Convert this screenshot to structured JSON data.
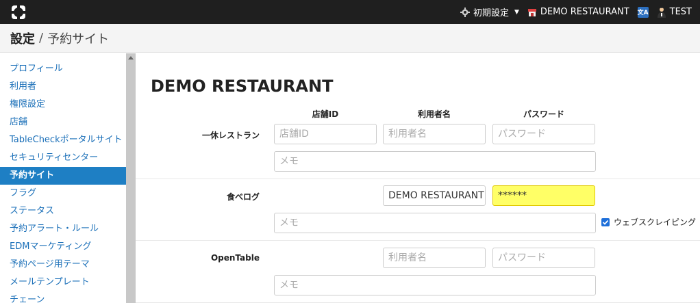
{
  "topbar": {
    "initial_settings": "初期設定",
    "restaurant": "DEMO RESTAURANT",
    "user": "TEST"
  },
  "breadcrumb": {
    "main": "設定",
    "separator": "/",
    "sub": "予約サイト"
  },
  "sidebar": {
    "items": [
      {
        "label": "プロフィール"
      },
      {
        "label": "利用者"
      },
      {
        "label": "権限設定"
      },
      {
        "label": "店舗"
      },
      {
        "label": "TableCheckポータルサイト"
      },
      {
        "label": "セキュリティセンター"
      },
      {
        "label": "予約サイト"
      },
      {
        "label": "フラグ"
      },
      {
        "label": "ステータス"
      },
      {
        "label": "予約アラート・ルール"
      },
      {
        "label": "EDMマーケティング"
      },
      {
        "label": "予約ページ用テーマ"
      },
      {
        "label": "メールテンプレート"
      },
      {
        "label": "チェーン"
      }
    ]
  },
  "main": {
    "title": "DEMO RESTAURANT",
    "columns": {
      "store_id": "店舗ID",
      "username": "利用者名",
      "password": "パスワード"
    },
    "sites": {
      "ikyu": {
        "label": "一休レストラン",
        "store_id_placeholder": "店舗ID",
        "username_placeholder": "利用者名",
        "password_placeholder": "パスワード",
        "memo_placeholder": "メモ"
      },
      "tabelog": {
        "label": "食べログ",
        "username_value": "DEMO RESTAURANT",
        "password_value": "******",
        "memo_placeholder": "メモ",
        "scraping_label": "ウェブスクレイピング",
        "scraping_checked": true
      },
      "opentable": {
        "label": "OpenTable",
        "username_placeholder": "利用者名",
        "password_placeholder": "パスワード",
        "memo_placeholder": "メモ"
      }
    }
  },
  "colors": {
    "topbar": "#1f1f1f",
    "active": "#1e7fc4",
    "link": "#1a6fb8",
    "highlight": "#ffff66"
  }
}
